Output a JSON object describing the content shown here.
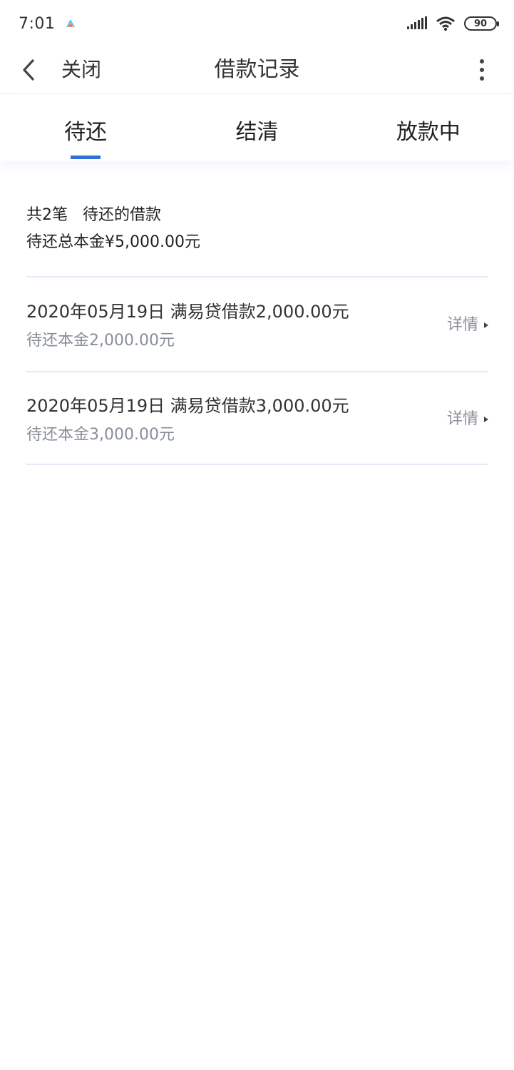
{
  "status_bar": {
    "time": "7:01",
    "battery": "90"
  },
  "header": {
    "close_label": "关闭",
    "title": "借款记录"
  },
  "tabs": [
    {
      "label": "待还",
      "active": true
    },
    {
      "label": "结清",
      "active": false
    },
    {
      "label": "放款中",
      "active": false
    }
  ],
  "summary": {
    "line1": "共2笔   待还的借款",
    "line2": "待还总本金¥5,000.00元"
  },
  "loans": [
    {
      "title": "2020年05月19日 满易贷借款2,000.00元",
      "principal": "待还本金2,000.00元",
      "detail_label": "详情"
    },
    {
      "title": "2020年05月19日 满易贷借款3,000.00元",
      "principal": "待还本金3,000.00元",
      "detail_label": "详情"
    }
  ],
  "colors": {
    "accent": "#2f6fd8",
    "divider": "#e3eaf5",
    "muted_text": "#888e99"
  }
}
